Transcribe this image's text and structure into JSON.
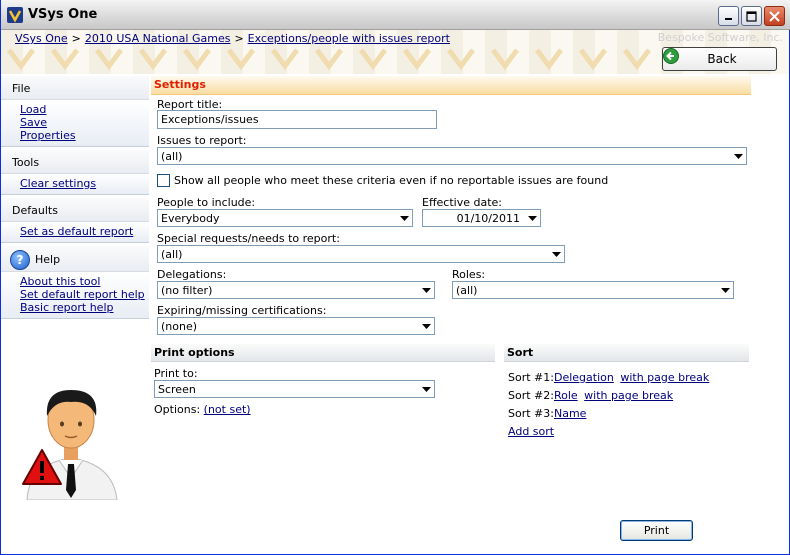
{
  "window": {
    "title": "VSys One",
    "vendor": "Bespoke Software, Inc."
  },
  "breadcrumb": [
    "VSys One",
    "2010 USA  National Games",
    "Exceptions/people with issues report"
  ],
  "back_label": "Back",
  "nav": {
    "file": {
      "title": "File",
      "items": [
        "Load",
        "Save",
        "Properties"
      ]
    },
    "tools": {
      "title": "Tools",
      "items": [
        "Clear settings"
      ]
    },
    "defaults": {
      "title": "Defaults",
      "items": [
        "Set as default report"
      ]
    },
    "help": {
      "title": "Help",
      "items": [
        "About this tool",
        "Set default report help",
        "Basic report help"
      ]
    }
  },
  "settings": {
    "header": "Settings",
    "report_title_label": "Report title:",
    "report_title_value": "Exceptions/issues",
    "issues_label": "Issues to report:",
    "issues_value": "(all)",
    "show_all_label": "Show all people who meet these criteria even if no reportable issues are found",
    "show_all_checked": false,
    "people_label": "People to include:",
    "people_value": "Everybody",
    "effective_label": "Effective date:",
    "effective_value": "01/10/2011",
    "special_label": "Special requests/needs to report:",
    "special_value": "(all)",
    "delegations_label": "Delegations:",
    "delegations_value": "(no filter)",
    "roles_label": "Roles:",
    "roles_value": "(all)",
    "certs_label": "Expiring/missing certifications:",
    "certs_value": "(none)"
  },
  "print_options": {
    "header": "Print options",
    "print_to_label": "Print to:",
    "print_to_value": "Screen",
    "options_label": "Options:",
    "options_link": "(not set)"
  },
  "sort": {
    "header": "Sort",
    "entries": [
      {
        "label": "Sort #1:",
        "field": "Delegation",
        "page_break": "with page break"
      },
      {
        "label": "Sort #2:",
        "field": "Role",
        "page_break": "with page break"
      },
      {
        "label": "Sort #3:",
        "field": "Name",
        "page_break": ""
      }
    ],
    "add_label": "Add sort"
  },
  "print_button": "Print",
  "colors": {
    "settings_header": "#e02000",
    "link": "#00007f",
    "accent_band": "#f9dca2"
  }
}
